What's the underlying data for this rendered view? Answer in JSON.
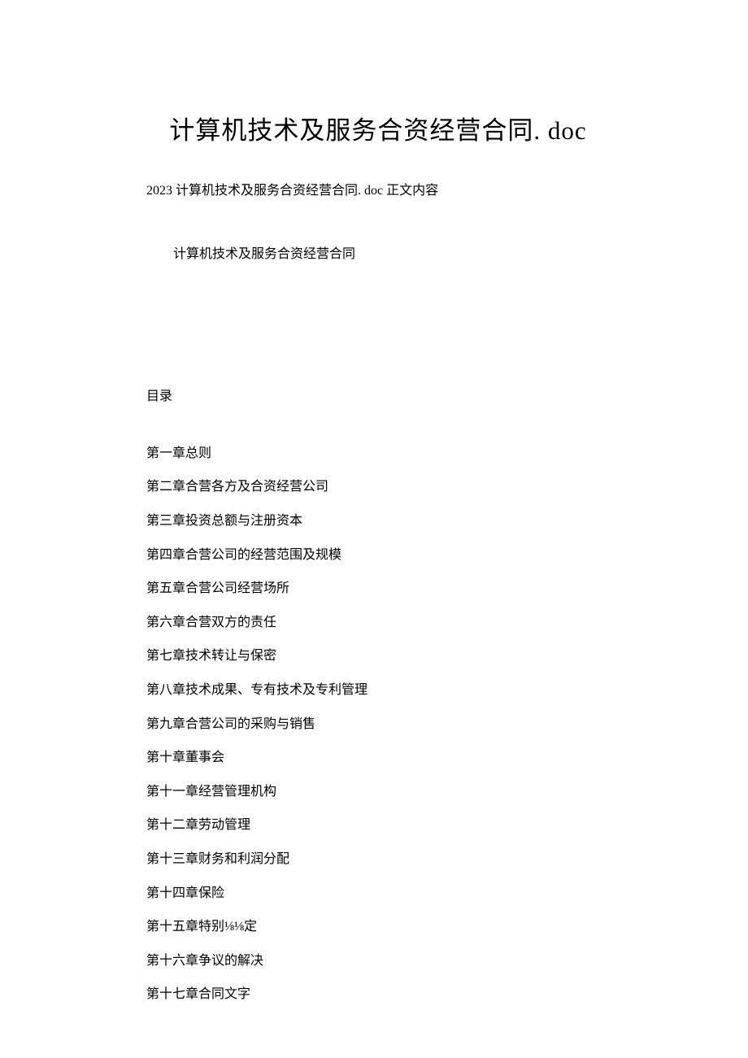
{
  "title": "计算机技术及服务合资经营合同. doc",
  "subtitle": "2023 计算机技术及服务合资经营合同. doc 正文内容",
  "indented_line": "计算机技术及服务合资经营合同",
  "section_label": "目录",
  "toc": [
    "第一章总则",
    "第二章合营各方及合资经营公司",
    "第三章投资总额与注册资本",
    "第四章合营公司的经营范围及规模",
    "第五章合营公司经营场所",
    "第六章合营双方的责任",
    "第七章技术转让与保密",
    "第八章技术成果、专有技术及专利管理",
    "第九章合营公司的采购与销售",
    "第十章董事会",
    "第十一章经营管理机构",
    "第十二章劳动管理",
    "第十三章财务和利润分配",
    "第十四章保险",
    "第十五章特别⅛⅛定",
    "第十六章争议的解决",
    "第十七章合同文字"
  ]
}
